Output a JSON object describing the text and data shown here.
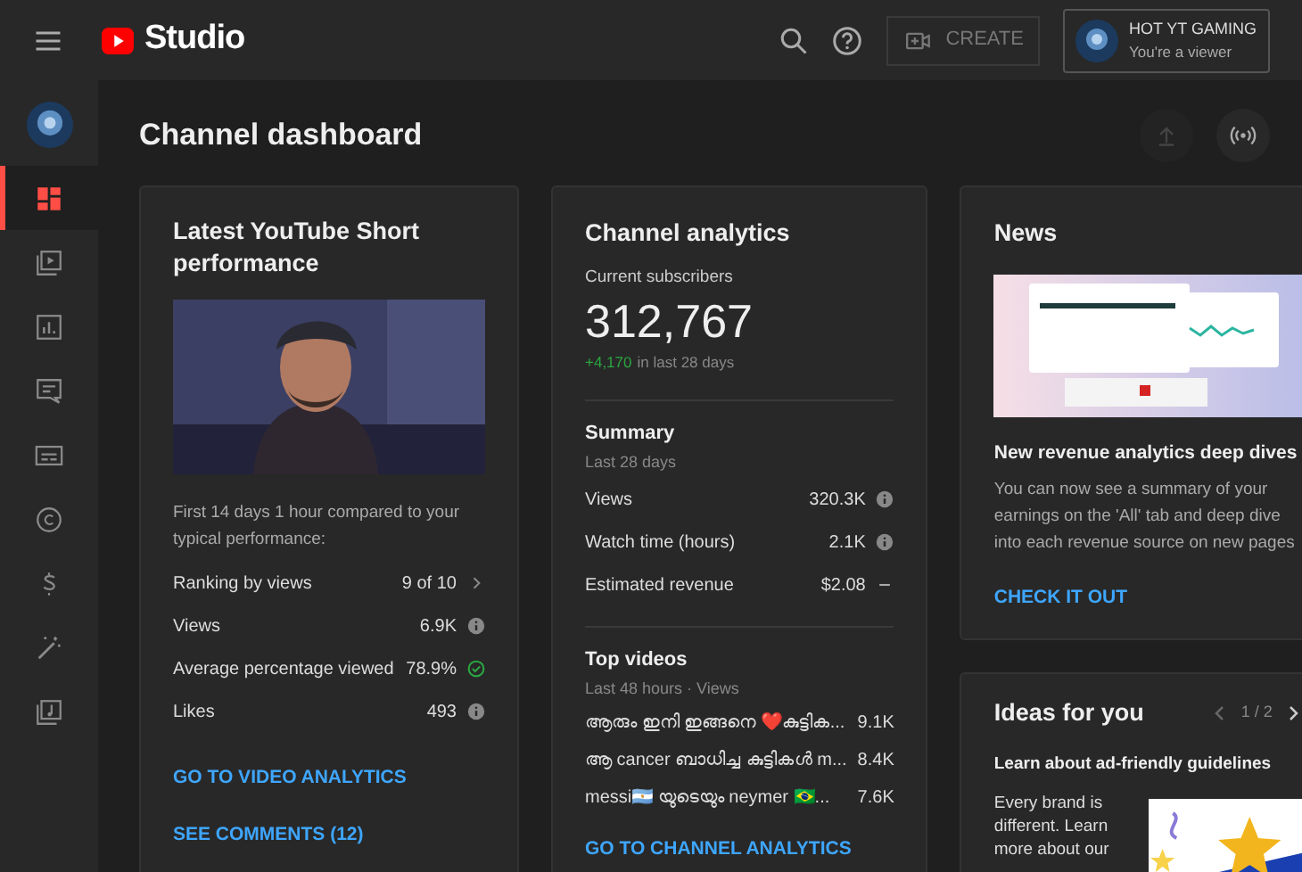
{
  "header": {
    "logo_text": "Studio",
    "create_label": "CREATE",
    "account": {
      "name": "HOT YT GAMING",
      "role": "You're a viewer"
    }
  },
  "sidebar": {
    "items": [
      {
        "kind": "dashboard",
        "selected": true
      },
      {
        "kind": "content",
        "selected": false
      },
      {
        "kind": "analytics",
        "selected": false
      },
      {
        "kind": "comments",
        "selected": false
      },
      {
        "kind": "subtitles",
        "selected": false
      },
      {
        "kind": "copyright",
        "selected": false
      },
      {
        "kind": "earn",
        "selected": false
      },
      {
        "kind": "customization",
        "selected": false
      },
      {
        "kind": "audio",
        "selected": false
      }
    ]
  },
  "page_title": "Channel dashboard",
  "short_card": {
    "title": "Latest YouTube Short performance",
    "note": "First 14 days 1 hour compared to your typical performance:",
    "metrics": [
      {
        "label": "Ranking by views",
        "value": "9 of 10",
        "kind": "chevron"
      },
      {
        "label": "Views",
        "value": "6.9K",
        "kind": "info"
      },
      {
        "label": "Average percentage viewed",
        "value": "78.9%",
        "kind": "check"
      },
      {
        "label": "Likes",
        "value": "493",
        "kind": "info"
      }
    ],
    "links": [
      "GO TO VIDEO ANALYTICS",
      "SEE COMMENTS (12)"
    ]
  },
  "analytics_card": {
    "title": "Channel analytics",
    "subscribers_label": "Current subscribers",
    "subscribers": "312,767",
    "change": "+4,170",
    "change_period": "in last 28 days",
    "summary": {
      "title": "Summary",
      "period": "Last 28 days",
      "rows": [
        {
          "label": "Views",
          "value": "320.3K",
          "kind": "info"
        },
        {
          "label": "Watch time (hours)",
          "value": "2.1K",
          "kind": "info"
        },
        {
          "label": "Estimated revenue",
          "value": "$2.08",
          "kind": "dash"
        }
      ]
    },
    "top_videos": {
      "title": "Top videos",
      "period": "Last 48 hours · Views",
      "rows": [
        {
          "title": "ആരും ഇനി ഇങ്ങനെ ❤️കുട്ടിക...",
          "views": "9.1K"
        },
        {
          "title": "ആ cancer ബാധിച്ച കുട്ടികൾ m...",
          "views": "8.4K"
        },
        {
          "title": "messi🇦🇷 യുടെയും neymer 🇧🇷...",
          "views": "7.6K"
        }
      ]
    },
    "link": "GO TO CHANNEL ANALYTICS"
  },
  "news_card": {
    "title": "News",
    "headline": "New revenue analytics deep dives",
    "body": "You can now see a summary of your earnings on the 'All' tab and deep dive into each revenue source on new pages",
    "link": "CHECK IT OUT"
  },
  "ideas_card": {
    "title": "Ideas for you",
    "pager": "1 / 2",
    "headline": "Learn about ad-friendly guidelines",
    "body": "Every brand is different. Learn more about our"
  }
}
